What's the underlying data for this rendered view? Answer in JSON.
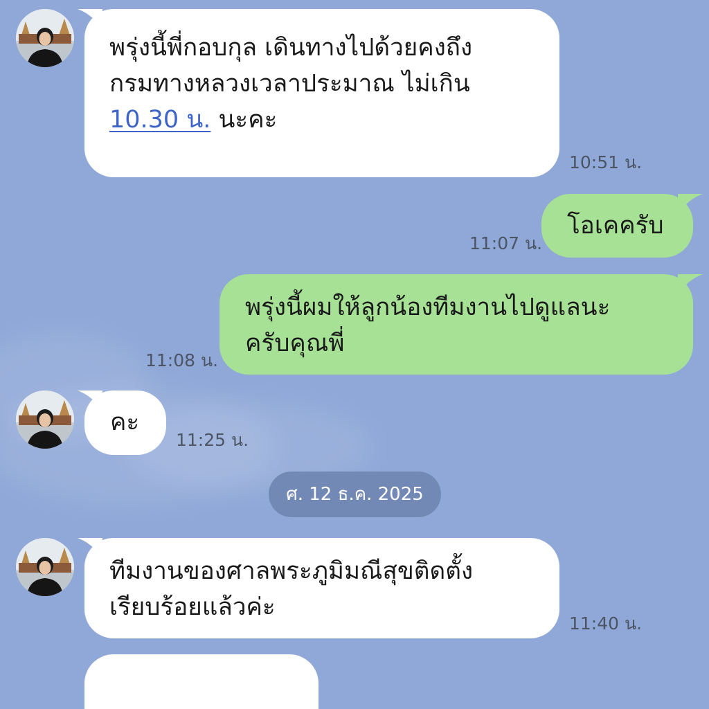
{
  "messages": [
    {
      "sender": "other",
      "line1": "พรุ่งนี้พี่กอบกุล เดินทางไปด้วยคงถึง",
      "line2": "กรมทางหลวงเวลาประมาณ ไม่เกิน",
      "link": "10.30 น.",
      "after_link": " นะคะ",
      "time": "10:51 น."
    },
    {
      "sender": "self",
      "text": "โอเคครับ",
      "time": "11:07 น."
    },
    {
      "sender": "self",
      "line1": "พรุ่งนี้ผมให้ลูกน้องทีมงานไปดูแลนะ",
      "line2": "ครับคุณพี่",
      "time": "11:08 น."
    },
    {
      "sender": "other",
      "text": "คะ",
      "time": "11:25 น."
    },
    {
      "sender": "other",
      "line1": "ทีมงานของศาลพระภูมิมณีสุขติดตั้ง",
      "line2": "เรียบร้อยแล้วค่ะ",
      "time": "11:40 น."
    },
    {
      "sender": "other",
      "text": ""
    }
  ],
  "date_separator": "ศ. 12 ธ.ค. 2025",
  "colors": {
    "background": "#8FA8D8",
    "incoming_bubble": "#FFFFFF",
    "outgoing_bubble": "#A6E196",
    "date_pill": "#7389B5",
    "link": "#3D64C8"
  },
  "icons": {
    "avatar": "contact-profile-photo"
  }
}
